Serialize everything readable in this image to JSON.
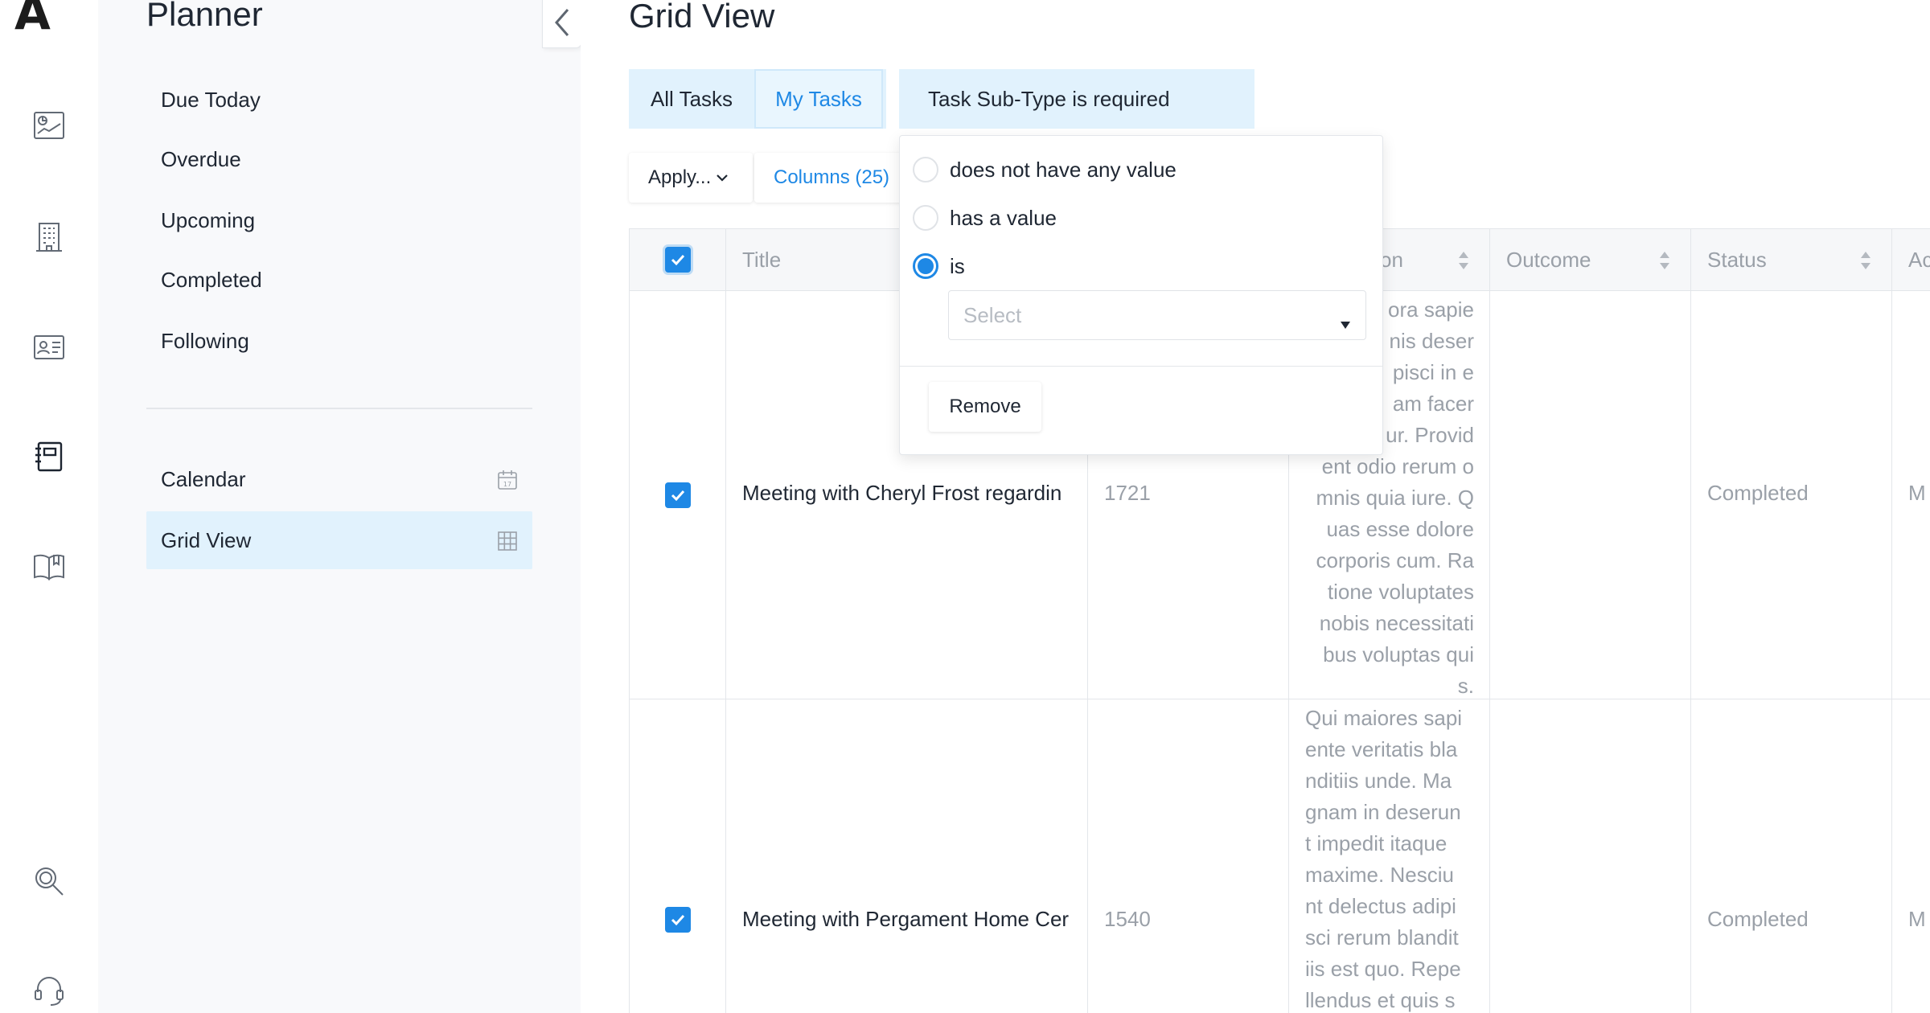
{
  "app": {
    "logo_text": "A"
  },
  "rail": {
    "items": [
      {
        "icon": "dashboard-chart-icon"
      },
      {
        "icon": "building-icon"
      },
      {
        "icon": "contact-card-icon"
      },
      {
        "icon": "planner-notebook-icon",
        "active": true
      },
      {
        "icon": "book-icon"
      },
      {
        "icon": "search-icon"
      },
      {
        "icon": "support-headset-icon"
      }
    ]
  },
  "sidebar": {
    "title": "Planner",
    "items": [
      {
        "label": "Due Today"
      },
      {
        "label": "Overdue"
      },
      {
        "label": "Upcoming"
      },
      {
        "label": "Completed"
      },
      {
        "label": "Following"
      }
    ],
    "views": [
      {
        "label": "Calendar",
        "icon": "calendar-icon"
      },
      {
        "label": "Grid View",
        "icon": "grid-icon",
        "selected": true
      }
    ]
  },
  "main": {
    "title": "Grid View",
    "tabs": [
      {
        "label": "All Tasks"
      },
      {
        "label": "My Tasks",
        "active": true
      }
    ],
    "filter_chip": "Task Sub-Type is required",
    "toolbar": {
      "apply_label": "Apply...",
      "columns_label": "Columns (25)"
    },
    "grid": {
      "columns": [
        "Title",
        "tion",
        "Outcome",
        "Status",
        "Ac"
      ],
      "rows": [
        {
          "title": "Meeting with Cheryl Frost regardin",
          "number": "1721",
          "description": "ora sapie\nnis deser\npisci in e\nam facer\nur. Provid\nent odio rerum o\nmnis quia iure. Q\nuas esse dolore\ncorporis cum. Ra\ntione voluptates\nnobis necessitati\nbus voluptas qui\ns.",
          "outcome": "",
          "status": "Completed",
          "extra": "M"
        },
        {
          "title": "Meeting with Pergament Home Cer",
          "number": "1540",
          "description": "Qui maiores sapi\nente veritatis bla\nnditiis unde. Ma\ngnam in deserun\nt impedit itaque\nmaxime. Nesciu\nnt delectus adipi\nsci rerum blandit\niis est quo. Repe\nllendus et quis s",
          "outcome": "",
          "status": "Completed",
          "extra": "M"
        }
      ]
    }
  },
  "popover": {
    "options": [
      {
        "label": "does not have any value",
        "checked": false
      },
      {
        "label": "has a value",
        "checked": false
      },
      {
        "label": "is",
        "checked": true
      }
    ],
    "select_placeholder": "Select",
    "remove_label": "Remove"
  },
  "colors": {
    "accent": "#1e88e5",
    "selected_bg": "#e1f2fd",
    "sidebar_bg": "#f8f9fb",
    "muted_text": "#9aa0a8"
  }
}
